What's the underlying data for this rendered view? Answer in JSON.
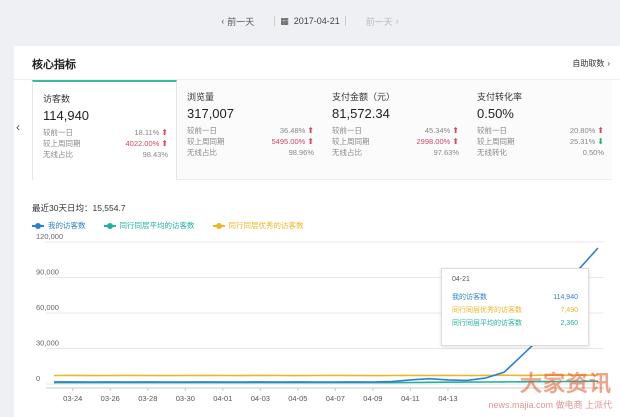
{
  "datebar": {
    "prev_label": "前一天",
    "date": "2017-04-21",
    "next_label": "前一天"
  },
  "panel": {
    "title": "核心指标",
    "action_label": "自助取数"
  },
  "cards": [
    {
      "title": "访客数",
      "value": "114,940",
      "rows": [
        {
          "label": "较前一日",
          "value": "18.11%",
          "trend": "up"
        },
        {
          "label": "较上周同期",
          "value": "4022.00%",
          "trend": "up"
        },
        {
          "label": "无线占比",
          "value": "98.43%",
          "trend": "none"
        }
      ]
    },
    {
      "title": "浏览量",
      "value": "317,007",
      "rows": [
        {
          "label": "较前一日",
          "value": "36.48%",
          "trend": "up"
        },
        {
          "label": "较上周同期",
          "value": "5495.00%",
          "trend": "up"
        },
        {
          "label": "无线占比",
          "value": "98.96%",
          "trend": "none"
        }
      ]
    },
    {
      "title": "支付金额（元）",
      "value": "81,572.34",
      "rows": [
        {
          "label": "较前一日",
          "value": "45.34%",
          "trend": "up"
        },
        {
          "label": "较上周同期",
          "value": "2998.00%",
          "trend": "up"
        },
        {
          "label": "无线占比",
          "value": "97.63%",
          "trend": "none"
        }
      ]
    },
    {
      "title": "支付转化率",
      "value": "0.50%",
      "rows": [
        {
          "label": "较前一日",
          "value": "20.80%",
          "trend": "up"
        },
        {
          "label": "较上周同期",
          "value": "25.31%",
          "trend": "down"
        },
        {
          "label": "无线转化",
          "value": "0.50%",
          "trend": "none"
        }
      ]
    }
  ],
  "average": {
    "label": "最近30天日均：",
    "value": "15,554.7"
  },
  "tooltip": {
    "date": "04-21",
    "rows": [
      {
        "label": "我的访客数",
        "value": "114,940",
        "color": "#2f7fd1"
      },
      {
        "label": "同行同层优秀的访客数",
        "value": "7,490",
        "color": "#f0b429"
      },
      {
        "label": "同行同层平均的访客数",
        "value": "2,360",
        "color": "#20b2a0"
      }
    ]
  },
  "watermark": {
    "brand": "大家资讯",
    "sub": "news.majia.com",
    "sub2": "做电商 上派代"
  },
  "chart_data": {
    "type": "line",
    "x": [
      "03-23",
      "03-24",
      "03-25",
      "03-26",
      "03-27",
      "03-28",
      "03-29",
      "03-30",
      "03-31",
      "04-01",
      "04-02",
      "04-03",
      "04-04",
      "04-05",
      "04-06",
      "04-07",
      "04-08",
      "04-09",
      "04-10",
      "04-11",
      "04-12",
      "04-13",
      "04-14",
      "04-15",
      "04-16",
      "04-17",
      "04-18",
      "04-19",
      "04-20",
      "04-21"
    ],
    "x_tick_labels": [
      "03-24",
      "03-26",
      "03-28",
      "03-30",
      "04-01",
      "04-03",
      "04-05",
      "04-07",
      "04-09",
      "04-11",
      "04-13"
    ],
    "ylim": [
      0,
      120000
    ],
    "y_ticks": [
      "0",
      "30,000",
      "60,000",
      "90,000",
      "120,000"
    ],
    "grid": true,
    "legend_position": "top-left",
    "series": [
      {
        "name": "我的访客数",
        "color": "#2f7fd1",
        "values": [
          1800,
          1800,
          1700,
          1800,
          1700,
          1800,
          1700,
          1700,
          1800,
          1700,
          1700,
          1800,
          1700,
          1800,
          1700,
          1700,
          1800,
          1700,
          2000,
          3500,
          4500,
          3500,
          3000,
          5000,
          10000,
          25000,
          40000,
          55000,
          97300,
          114940
        ]
      },
      {
        "name": "同行同层平均的访客数",
        "color": "#20b2a0",
        "values": [
          1200,
          1200,
          1200,
          1200,
          1200,
          1200,
          1200,
          1200,
          1200,
          1200,
          1200,
          1200,
          1200,
          1200,
          1200,
          1200,
          1200,
          1200,
          1200,
          1300,
          1400,
          1500,
          1600,
          1700,
          1800,
          1900,
          2000,
          2100,
          2200,
          2360
        ]
      },
      {
        "name": "同行同层优秀的访客数",
        "color": "#f0b429",
        "values": [
          7200,
          7300,
          7100,
          7200,
          7300,
          7200,
          7100,
          7200,
          7300,
          7200,
          7100,
          7300,
          7200,
          7100,
          7200,
          7300,
          7200,
          7100,
          7200,
          7300,
          7200,
          7300,
          7200,
          7300,
          7400,
          7300,
          7400,
          7400,
          7450,
          7490
        ]
      }
    ]
  }
}
